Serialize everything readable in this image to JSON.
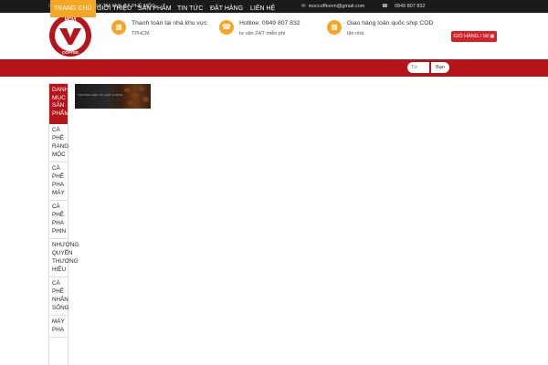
{
  "topbar": {
    "company": "CÔNG TY TNHH SX TM XNK CÀ PHÊ MỘC",
    "email": "moccoffeevn@gmail.com",
    "phone": "0949 807 832",
    "home_icon": "home-icon",
    "mail_icon": "mail-icon",
    "phone_icon": "phone-icon"
  },
  "logo": {
    "top_text": "MOVI",
    "bottom_text": "COFFEE"
  },
  "features": [
    {
      "line1": "Thanh toán tại nhà khu vực",
      "line2": "TPHCM",
      "icon": "truck-icon"
    },
    {
      "line1": "Hotline: 0949 807 832",
      "line2": "tư vấn 24/7 miễn phí",
      "icon": "phone-icon"
    },
    {
      "line1": "Giao hàng toàn quốc ship COD",
      "line2": "tận nhà",
      "icon": "truck-icon"
    }
  ],
  "cart": {
    "label": "GIỎ HÀNG / 0đ",
    "icon": "bag-icon"
  },
  "nav": {
    "items": [
      "Trang chủ",
      "Giới thiệu",
      "Sản phẩm",
      "Tin tức",
      "Đặt hàng",
      "Liên hệ"
    ],
    "search_placeholder": "Từ",
    "search_button": "Bạn"
  },
  "sidebar": {
    "title": "DANH MỤC SẢN PHẨM",
    "title_lines": [
      "DANH",
      "MỤC",
      "SẢN",
      "PHẨM"
    ],
    "categories": [
      [
        "CÀ",
        "PHÊ",
        "RANG",
        "MỘC"
      ],
      [
        "CÀ",
        "PHÊ",
        "PHA",
        "MÁY"
      ],
      [
        "CÀ",
        "PHÊ",
        "PHA",
        "PHIN"
      ],
      [
        "NHƯỢNG",
        "QUYỀN",
        "THƯƠNG",
        "HIỆU"
      ],
      [
        "CÀ",
        "PHÊ",
        "NHÂN",
        "SỐNG"
      ],
      [
        "MÁY",
        "PHA"
      ]
    ]
  },
  "banner": {
    "text": "THƯƠNG HIỆU VÀ CHẤT LƯỢNG"
  },
  "colors": {
    "brand_red": "#b5141b",
    "accent_orange": "#f5a623",
    "topbar": "#1a1a1a"
  }
}
